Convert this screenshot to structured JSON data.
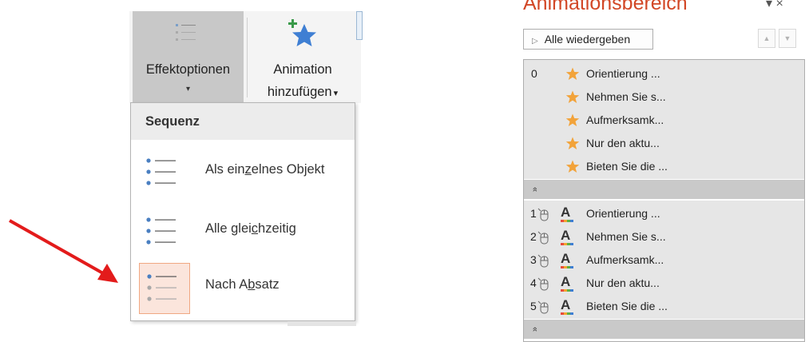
{
  "ribbon": {
    "effect_options_label": "Effektoptionen",
    "effect_options_caret": "▾",
    "add_animation_line1": "Animation",
    "add_animation_line2": "hinzufügen",
    "add_animation_caret": "▾"
  },
  "menu": {
    "header": "Sequenz",
    "items": [
      {
        "pre": "Als ein",
        "key": "z",
        "post": "elnes Objekt",
        "selected": false
      },
      {
        "pre": "Alle glei",
        "key": "c",
        "post": "hzeitig",
        "selected": false
      },
      {
        "pre": "Nach A",
        "key": "b",
        "post": "satz",
        "selected": true
      }
    ]
  },
  "pane": {
    "title": "Animationsbereich",
    "window_controls": "▾ ×",
    "play_all_label": "Alle wiedergeben",
    "move_up_icon": "▲",
    "move_down_icon": "▼",
    "collapse_icon": "»",
    "group0": {
      "number": "0",
      "items": [
        "Orientierung ...",
        "Nehmen Sie s...",
        "Aufmerksamk...",
        "Nur den aktu...",
        "Bieten Sie die ..."
      ]
    },
    "group1": {
      "items": [
        {
          "number": "1",
          "label": "Orientierung ..."
        },
        {
          "number": "2",
          "label": "Nehmen Sie s..."
        },
        {
          "number": "3",
          "label": "Aufmerksamk..."
        },
        {
          "number": "4",
          "label": "Nur den aktu..."
        },
        {
          "number": "5",
          "label": "Bieten Sie die ..."
        }
      ]
    },
    "effect_glyph": "A"
  },
  "colors": {
    "pane_title": "#d24726",
    "star": "#f2a33a",
    "arrow": "#e31b1b",
    "selected_bg": "#fbe5dc",
    "selected_border": "#f0a882",
    "bullet": "#4a7fc1"
  }
}
